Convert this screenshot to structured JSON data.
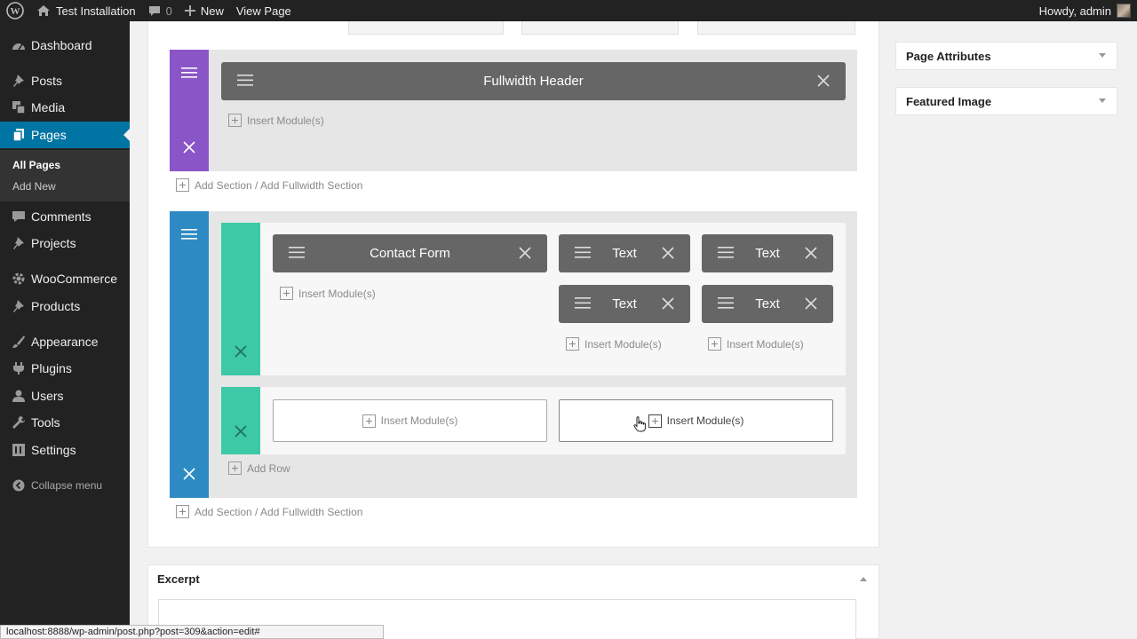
{
  "adminbar": {
    "site_name": "Test Installation",
    "comments_count": "0",
    "new_label": "New",
    "view_page_label": "View Page",
    "greeting": "Howdy, admin"
  },
  "sidebar": {
    "items": [
      {
        "label": "Dashboard",
        "icon": "dashboard-icon"
      },
      {
        "label": "Posts",
        "icon": "pin-icon"
      },
      {
        "label": "Media",
        "icon": "media-icon"
      },
      {
        "label": "Pages",
        "icon": "pages-icon"
      },
      {
        "label": "Comments",
        "icon": "comment-icon"
      },
      {
        "label": "Projects",
        "icon": "pin-icon"
      },
      {
        "label": "WooCommerce",
        "icon": "gear-icon"
      },
      {
        "label": "Products",
        "icon": "pin-icon"
      },
      {
        "label": "Appearance",
        "icon": "brush-icon"
      },
      {
        "label": "Plugins",
        "icon": "plug-icon"
      },
      {
        "label": "Users",
        "icon": "users-icon"
      },
      {
        "label": "Tools",
        "icon": "wrench-icon"
      },
      {
        "label": "Settings",
        "icon": "settings-icon"
      }
    ],
    "submenu": [
      "All Pages",
      "Add New"
    ],
    "collapse_label": "Collapse menu"
  },
  "builder": {
    "section1": {
      "module_title": "Fullwidth Header",
      "insert_label": "Insert Module(s)",
      "color": "#8a55c6"
    },
    "add_section_label": "Add Section / Add Fullwidth Section",
    "section2": {
      "color": "#2e8ac3",
      "row_color": "#3dc9a5",
      "contact_form": "Contact Form",
      "text_modules": [
        "Text",
        "Text",
        "Text",
        "Text"
      ],
      "insert_label": "Insert Module(s)",
      "add_row_label": "Add Row"
    }
  },
  "right_sidebar": {
    "page_attributes": "Page Attributes",
    "featured_image": "Featured Image"
  },
  "excerpt": {
    "title": "Excerpt"
  },
  "statusbar": {
    "url": "localhost:8888/wp-admin/post.php?post=309&action=edit#"
  }
}
